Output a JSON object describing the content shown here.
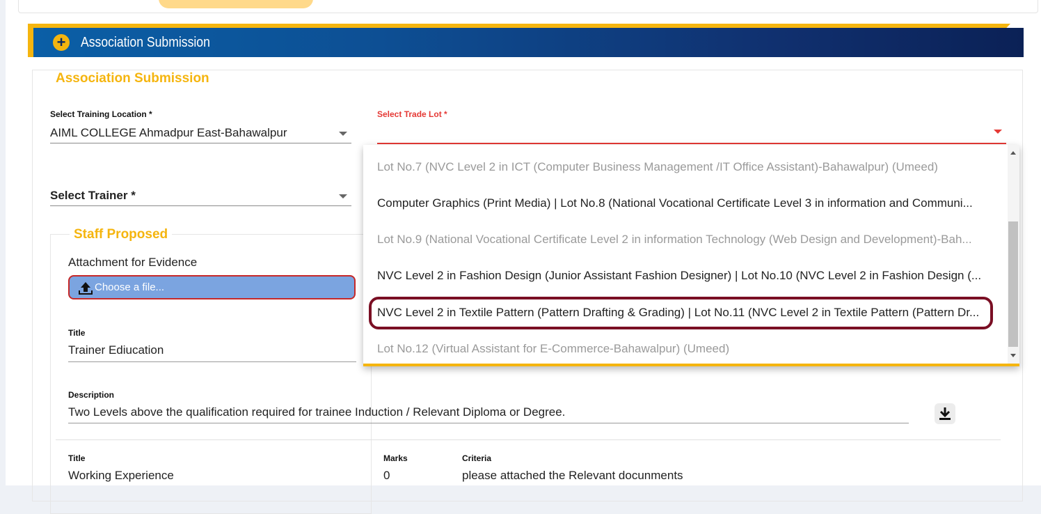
{
  "panel": {
    "header_title": "Association Submission",
    "legend": "Association Submission"
  },
  "training_location": {
    "label": "Select Training Location *",
    "value": "AIML COLLEGE Ahmadpur East-Bahawalpur"
  },
  "trade_lot": {
    "label": "Select Trade Lot *",
    "value": ""
  },
  "trainer": {
    "label": "Select Trainer *"
  },
  "staff": {
    "legend": "Staff Proposed",
    "evidence_label": "Attachment for Evidence",
    "file_button_text": "Choose a file...",
    "title_label": "Title",
    "title_value": "Trainer Ediucation",
    "description_label": "Description",
    "description_value": "Two Levels above the qualification required for trainee Induction / Relevant Diploma or Degree."
  },
  "experience": {
    "title_label": "Title",
    "title_value": "Working Experience",
    "marks_label": "Marks",
    "marks_value": "0",
    "criteria_label": "Criteria",
    "criteria_value": "please attached the Relevant docunments"
  },
  "dropdown": {
    "options": [
      {
        "label": "Lot No.7 (NVC Level 2 in ICT (Computer Business Management /IT Office Assistant)-Bahawalpur) (Umeed)",
        "disabled": true
      },
      {
        "label": "Computer Graphics (Print Media) | Lot No.8 (National Vocational Certificate Level 3 in information and Communi...",
        "disabled": false
      },
      {
        "label": "Lot No.9 (National Vocational Certificate Level 2 in information Technology (Web Design and Development)-Bah...",
        "disabled": true
      },
      {
        "label": "NVC Level 2 in Fashion Design (Junior Assistant Fashion Designer) | Lot No.10 (NVC Level 2 in Fashion Design (...",
        "disabled": false
      },
      {
        "label": "NVC Level 2 in Textile Pattern (Pattern Drafting & Grading) | Lot No.11 (NVC Level 2 in Textile Pattern (Pattern Dr...",
        "disabled": false
      },
      {
        "label": "Lot No.12 (Virtual Assistant for E-Commerce-Bahawalpur) (Umeed)",
        "disabled": true
      }
    ]
  },
  "colors": {
    "accent": "#f5b50f",
    "header_start": "#0b5fa6",
    "header_end": "#0b2156",
    "error": "#e53935",
    "highlight": "#7a0f24"
  }
}
